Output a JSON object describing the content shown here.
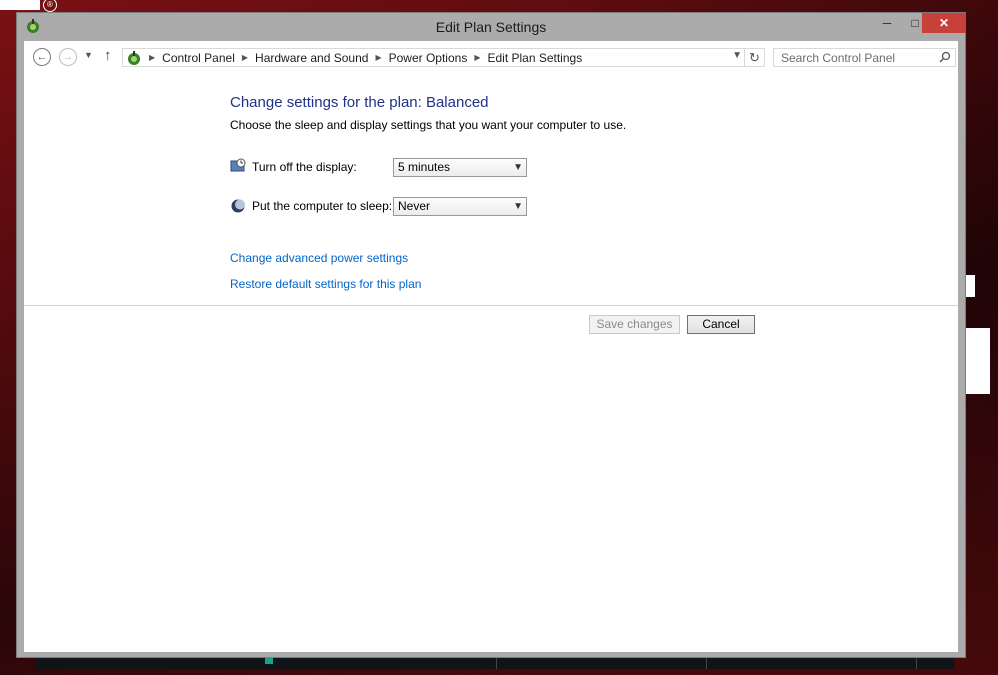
{
  "window": {
    "title": "Edit Plan Settings",
    "controls": {
      "minimize": "─",
      "maximize": "□",
      "close": "✕"
    }
  },
  "nav": {
    "back_icon": "back-arrow-icon",
    "forward_icon": "forward-arrow-icon",
    "recent_icon": "chevron-down-icon",
    "up_icon": "up-arrow-icon",
    "refresh_icon": "refresh-icon"
  },
  "breadcrumb": [
    "Control Panel",
    "Hardware and Sound",
    "Power Options",
    "Edit Plan Settings"
  ],
  "search": {
    "placeholder": "Search Control Panel"
  },
  "main": {
    "heading": "Change settings for the plan: Balanced",
    "subheading": "Choose the sleep and display settings that you want your computer to use.",
    "display": {
      "label": "Turn off the display:",
      "value": "5 minutes"
    },
    "sleep": {
      "label": "Put the computer to sleep:",
      "value": "Never"
    },
    "links": {
      "advanced": "Change advanced power settings",
      "restore": "Restore default settings for this plan"
    },
    "buttons": {
      "save": "Save changes",
      "cancel": "Cancel"
    }
  },
  "colors": {
    "heading": "#1e3287",
    "link": "#0066cc",
    "close_button": "#c7403a"
  }
}
